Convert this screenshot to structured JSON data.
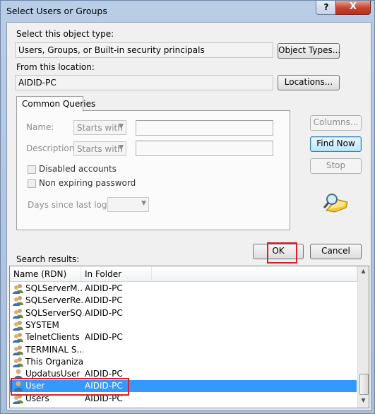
{
  "window": {
    "title": "Select Users or Groups",
    "help": "?",
    "close": "X"
  },
  "object_type": {
    "label": "Select this object type:",
    "value": "Users, Groups, or Built-in security principals",
    "button": "Object Types..."
  },
  "location": {
    "label": "From this location:",
    "value": "AIDID-PC",
    "button": "Locations..."
  },
  "queries": {
    "tab": "Common Queries",
    "name_label": "Name:",
    "name_mode": "Starts with",
    "description_label": "Description:",
    "description_mode": "Starts with",
    "disabled_accounts": "Disabled accounts",
    "non_expiring_password": "Non expiring password",
    "days_since_logon": "Days since last logon:"
  },
  "side_buttons": {
    "columns": "Columns...",
    "find_now": "Find Now",
    "stop": "Stop"
  },
  "actions": {
    "ok": "OK",
    "cancel": "Cancel"
  },
  "results": {
    "label": "Search results:",
    "columns": [
      "Name (RDN)",
      "In Folder"
    ],
    "rows": [
      {
        "name": "SQLServerM...",
        "folder": "AIDID-PC",
        "icon": "group-icon"
      },
      {
        "name": "SQLServerRe...",
        "folder": "AIDID-PC",
        "icon": "group-icon"
      },
      {
        "name": "SQLServerSQ...",
        "folder": "AIDID-PC",
        "icon": "group-icon"
      },
      {
        "name": "SYSTEM",
        "folder": "",
        "icon": "group-icon"
      },
      {
        "name": "TelnetClients",
        "folder": "AIDID-PC",
        "icon": "group-icon"
      },
      {
        "name": "TERMINAL S...",
        "folder": "",
        "icon": "group-icon"
      },
      {
        "name": "This Organiza...",
        "folder": "",
        "icon": "group-icon"
      },
      {
        "name": "UpdatusUser",
        "folder": "AIDID-PC",
        "icon": "user-icon"
      },
      {
        "name": "User",
        "folder": "AIDID-PC",
        "icon": "user-icon",
        "selected": true
      },
      {
        "name": "Users",
        "folder": "AIDID-PC",
        "icon": "group-icon"
      }
    ]
  },
  "colors": {
    "highlight": "#3399ff",
    "annotation_red": "#d9202a"
  }
}
